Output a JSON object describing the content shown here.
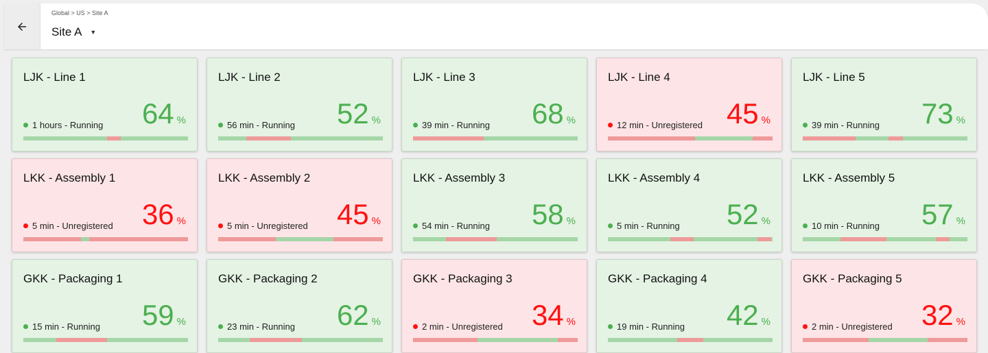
{
  "header": {
    "breadcrumb": "Global > US > Site A",
    "site_title": "Site A",
    "back_icon": "arrow-left-icon",
    "dropdown_icon": "caret-down-icon"
  },
  "colors": {
    "green": "#4caf50",
    "red": "#ff1111",
    "bar_green": "#a5d6a7",
    "bar_red": "#ef9a9a"
  },
  "cards": [
    {
      "name": "LJK - Line 1",
      "status": "1 hours - Running",
      "state": "running",
      "percent": "64",
      "percent_sign": "%",
      "timeline": [
        [
          "g",
          0.51
        ],
        [
          "r",
          0.08
        ],
        [
          "g",
          0.41
        ]
      ]
    },
    {
      "name": "LJK - Line 2",
      "status": "56 min - Running",
      "state": "running",
      "percent": "52",
      "percent_sign": "%",
      "timeline": [
        [
          "g",
          0.17
        ],
        [
          "r",
          0.27
        ],
        [
          "g",
          0.56
        ]
      ]
    },
    {
      "name": "LJK - Line 3",
      "status": "39 min - Running",
      "state": "running",
      "percent": "68",
      "percent_sign": "%",
      "timeline": [
        [
          "r",
          0.43
        ],
        [
          "g",
          0.57
        ]
      ]
    },
    {
      "name": "LJK - Line 4",
      "status": "12 min - Unregistered",
      "state": "unregistered",
      "percent": "45",
      "percent_sign": "%",
      "timeline": [
        [
          "r",
          0.53
        ],
        [
          "g",
          0.35
        ],
        [
          "r",
          0.12
        ]
      ]
    },
    {
      "name": "LJK - Line 5",
      "status": "39 min - Running",
      "state": "running",
      "percent": "73",
      "percent_sign": "%",
      "timeline": [
        [
          "r",
          0.32
        ],
        [
          "g",
          0.2
        ],
        [
          "r",
          0.09
        ],
        [
          "g",
          0.39
        ]
      ]
    },
    {
      "name": "LKK - Assembly 1",
      "status": "5 min - Unregistered",
      "state": "unregistered",
      "percent": "36",
      "percent_sign": "%",
      "timeline": [
        [
          "r",
          0.35
        ],
        [
          "g",
          0.05
        ],
        [
          "r",
          0.6
        ]
      ]
    },
    {
      "name": "LKK - Assembly 2",
      "status": "5 min - Unregistered",
      "state": "unregistered",
      "percent": "45",
      "percent_sign": "%",
      "timeline": [
        [
          "r",
          0.35
        ],
        [
          "g",
          0.35
        ],
        [
          "r",
          0.3
        ]
      ]
    },
    {
      "name": "LKK - Assembly 3",
      "status": "54 min - Running",
      "state": "running",
      "percent": "58",
      "percent_sign": "%",
      "timeline": [
        [
          "g",
          0.2
        ],
        [
          "r",
          0.31
        ],
        [
          "g",
          0.49
        ]
      ]
    },
    {
      "name": "LKK - Assembly 4",
      "status": "5 min - Running",
      "state": "running",
      "percent": "52",
      "percent_sign": "%",
      "timeline": [
        [
          "g",
          0.38
        ],
        [
          "r",
          0.14
        ],
        [
          "g",
          0.39
        ],
        [
          "r",
          0.08
        ],
        [
          "g",
          0.01
        ]
      ]
    },
    {
      "name": "LKK - Assembly 5",
      "status": "10 min - Running",
      "state": "running",
      "percent": "57",
      "percent_sign": "%",
      "timeline": [
        [
          "g",
          0.23
        ],
        [
          "r",
          0.28
        ],
        [
          "g",
          0.3
        ],
        [
          "r",
          0.08
        ],
        [
          "g",
          0.11
        ]
      ]
    },
    {
      "name": "GKK - Packaging 1",
      "status": "15 min - Running",
      "state": "running",
      "percent": "59",
      "percent_sign": "%",
      "timeline": [
        [
          "g",
          0.2
        ],
        [
          "r",
          0.31
        ],
        [
          "g",
          0.49
        ]
      ]
    },
    {
      "name": "GKK - Packaging 2",
      "status": "23 min - Running",
      "state": "running",
      "percent": "62",
      "percent_sign": "%",
      "timeline": [
        [
          "g",
          0.19
        ],
        [
          "r",
          0.32
        ],
        [
          "g",
          0.49
        ]
      ]
    },
    {
      "name": "GKK - Packaging 3",
      "status": "2 min - Unregistered",
      "state": "unregistered",
      "percent": "34",
      "percent_sign": "%",
      "timeline": [
        [
          "r",
          0.39
        ],
        [
          "g",
          0.49
        ],
        [
          "r",
          0.12
        ]
      ]
    },
    {
      "name": "GKK - Packaging 4",
      "status": "19 min - Running",
      "state": "running",
      "percent": "42",
      "percent_sign": "%",
      "timeline": [
        [
          "g",
          0.42
        ],
        [
          "r",
          0.16
        ],
        [
          "g",
          0.42
        ]
      ]
    },
    {
      "name": "GKK - Packaging 5",
      "status": "2 min - Unregistered",
      "state": "unregistered",
      "percent": "32",
      "percent_sign": "%",
      "timeline": [
        [
          "r",
          0.4
        ],
        [
          "g",
          0.36
        ],
        [
          "r",
          0.24
        ]
      ]
    }
  ]
}
